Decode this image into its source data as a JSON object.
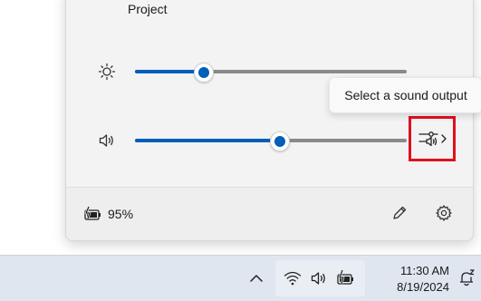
{
  "quick_settings": {
    "tile_label": "Project",
    "brightness": {
      "value": 0.25,
      "icon": "brightness-icon"
    },
    "volume": {
      "value": 0.53,
      "icon": "speaker-icon"
    },
    "sound_output_tooltip": "Select a sound output",
    "battery": {
      "percent_label": "95%",
      "icon": "battery-charging-icon"
    },
    "footer": {
      "edit_icon": "pencil-icon",
      "settings_icon": "gear-icon"
    },
    "accent_color": "#005fb8",
    "highlight_color": "#e01020"
  },
  "taskbar": {
    "tray_icons": [
      "chevron-up-icon",
      "wifi-icon",
      "speaker-icon",
      "battery-charging-icon"
    ],
    "clock": {
      "time": "11:30 AM",
      "date": "8/19/2024"
    },
    "notification_icon": "notification-bell-icon"
  }
}
